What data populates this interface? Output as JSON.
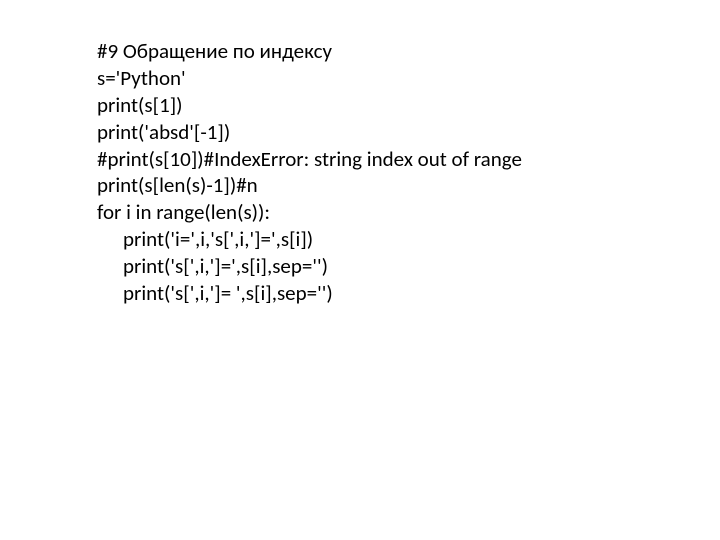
{
  "code": {
    "line1": "#9 Обращение по индексу",
    "line2": "s='Python'",
    "line3": "print(s[1])",
    "line4": "print('absd'[-1])",
    "line5": "#print(s[10])#IndexError: string index out of range",
    "line6": "print(s[len(s)-1])#n",
    "line7": "for i in range(len(s)):",
    "line8": "print('i=',i,'s[',i,']=',s[i])",
    "line9": "print('s[',i,']=',s[i],sep='')",
    "line10": "print('s[',i,']= ',s[i],sep='')"
  }
}
